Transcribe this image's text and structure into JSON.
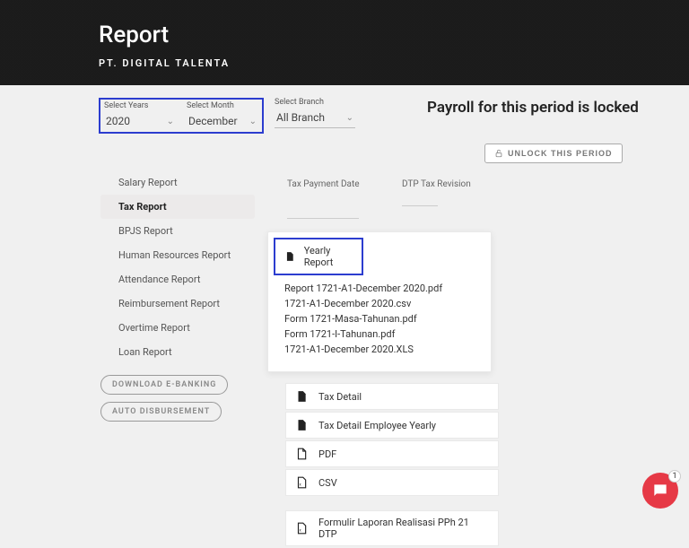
{
  "hero": {
    "title": "Report",
    "subtitle": "PT. DIGITAL TALENTA"
  },
  "filters": {
    "year_label": "Select Years",
    "year_value": "2020",
    "month_label": "Select Month",
    "month_value": "December",
    "branch_label": "Select Branch",
    "branch_value": "All Branch"
  },
  "status": {
    "heading": "Payroll for this period is locked",
    "unlock_label": "UNLOCK THIS PERIOD"
  },
  "sidebar": {
    "items": [
      {
        "label": "Salary Report"
      },
      {
        "label": "Tax Report"
      },
      {
        "label": "BPJS Report"
      },
      {
        "label": "Human Resources Report"
      },
      {
        "label": "Attendance Report"
      },
      {
        "label": "Reimbursement Report"
      },
      {
        "label": "Overtime Report"
      },
      {
        "label": "Loan Report"
      }
    ],
    "btn1": "DOWNLOAD E-BANKING",
    "btn2": "AUTO DISBURSEMENT"
  },
  "tax_head": {
    "col1": "Tax Payment Date",
    "col2": "DTP Tax Revision"
  },
  "yearly": {
    "title": "Yearly Report",
    "files": [
      "Report 1721-A1-December 2020.pdf",
      "1721-A1-December 2020.csv",
      "Form 1721-Masa-Tahunan.pdf",
      "Form 1721-I-Tahunan.pdf",
      "1721-A1-December 2020.XLS"
    ]
  },
  "options": [
    {
      "icon": "file",
      "label": "Tax Detail"
    },
    {
      "icon": "file",
      "label": "Tax Detail Employee Yearly"
    },
    {
      "icon": "pdf",
      "label": "PDF"
    },
    {
      "icon": "csv",
      "label": "CSV"
    }
  ],
  "option_last": {
    "icon": "xls",
    "label": "Formulir Laporan Realisasi PPh 21 DTP"
  },
  "chat_badge": "1"
}
